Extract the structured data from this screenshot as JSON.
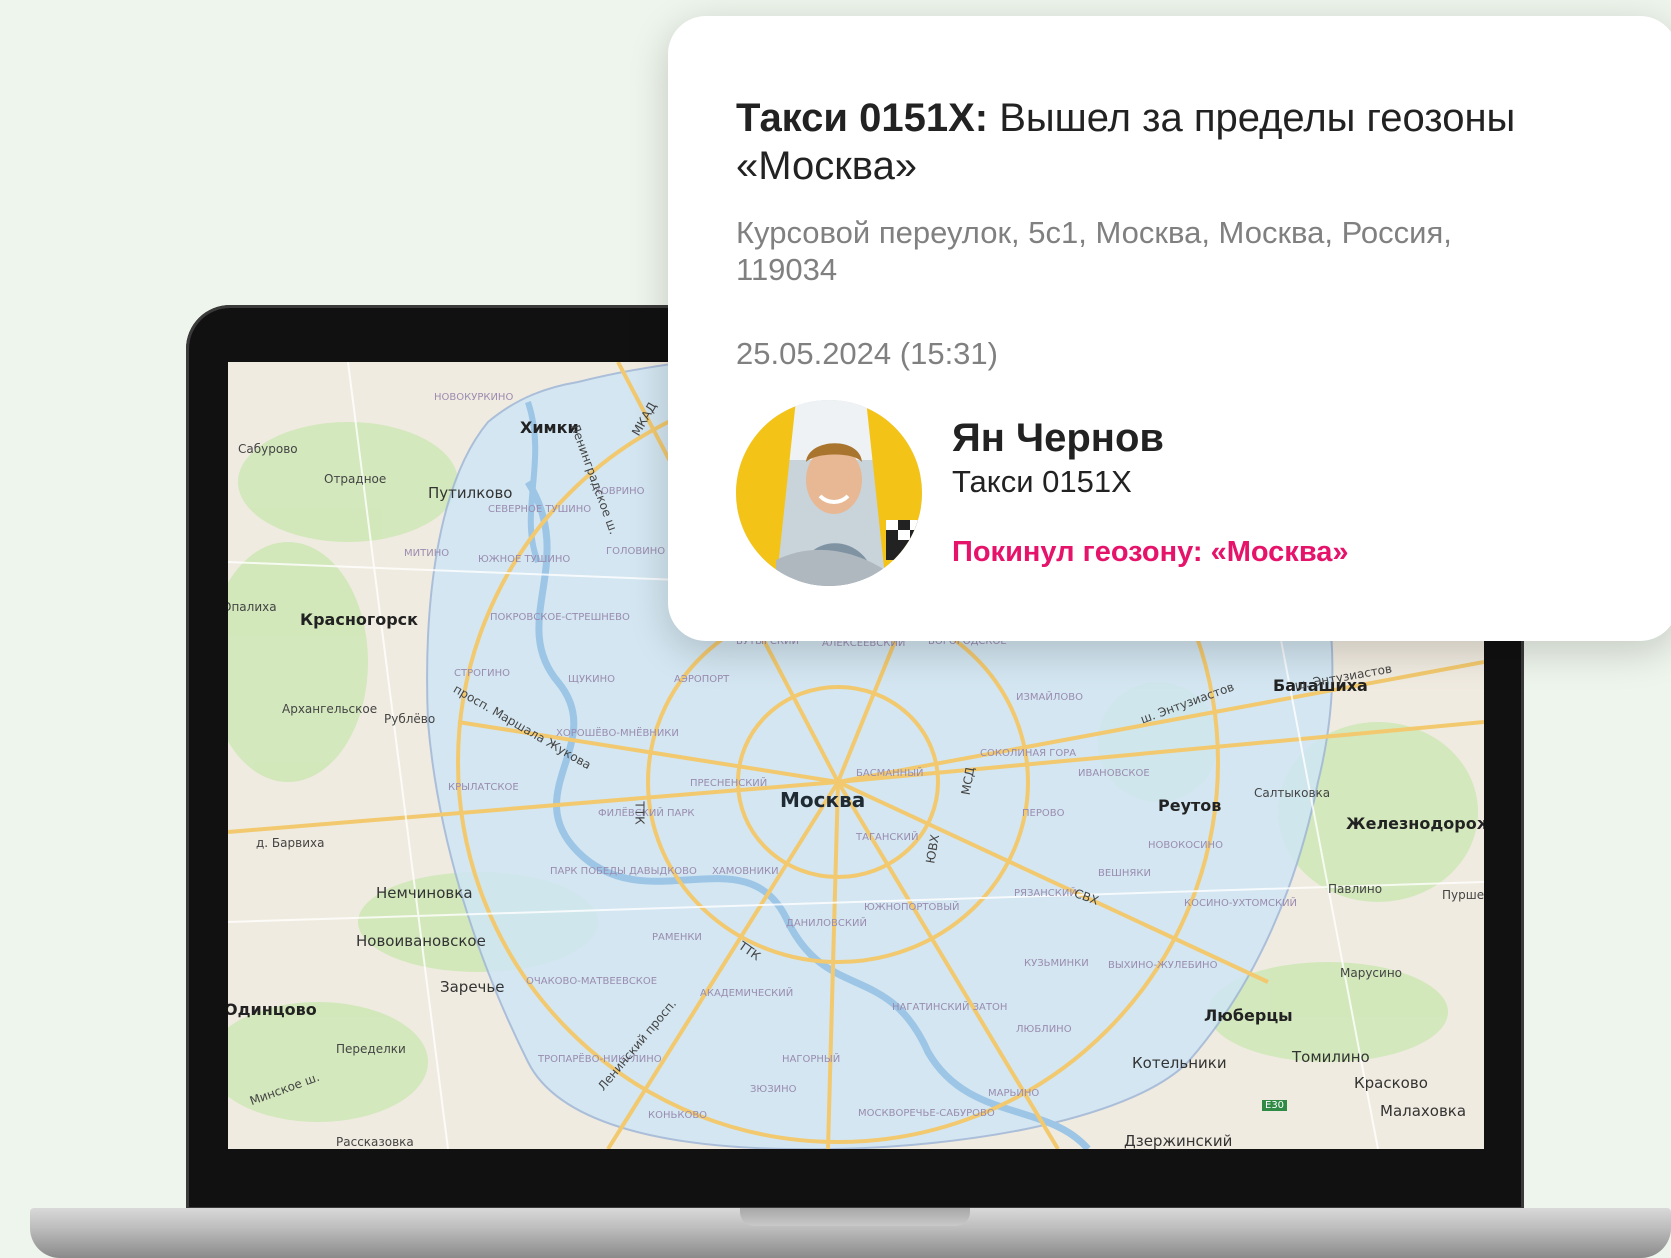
{
  "notification": {
    "title_bold": "Такси 0151X:",
    "title_rest": " Вышел за пределы геозоны «Москва»",
    "address": "Курсовой переулок, 5с1, Москва, Москва, Россия, 119034",
    "datetime": "25.05.2024 (15:31)",
    "driver_name": "Ян Чернов",
    "vehicle": "Такси 0151X",
    "event": "Покинул геозону: «Москва»",
    "event_color": "#e6136b"
  },
  "map": {
    "geofence_color": "#cfe6f5",
    "labels": {
      "khimki": "Химки",
      "sabu": "Сабурово",
      "otradnoe": "Отрадное",
      "putilkovo": "Путилково",
      "krasnogorsk": "Красногорск",
      "opalikha": "Опалиха",
      "arkhangelskoe": "Архангельское",
      "rublevo": "Рублёво",
      "barvikha": "д. Барвиха",
      "nemchinovka": "Немчиновка",
      "novoivanovskoe": "Новоивановское",
      "zarechye": "Заречье",
      "odintsovo": "Одинцово",
      "peredelki": "Переделки",
      "rasskazovka": "Рассказовка",
      "moskva": "Москва",
      "balashikha": "Балашиха",
      "reutov": "Реутов",
      "saltykovka": "Салтыковка",
      "zheleznodorozhny": "Железнодорожный",
      "pavlino": "Павлино",
      "purshevo": "Пуршево",
      "marusino": "Марусино",
      "lyubertsy": "Люберцы",
      "kotelniki": "Котельники",
      "tomilino": "Томилино",
      "kraskovo": "Красково",
      "malakhovka": "Малаховка",
      "dzerzhinsky": "Дзержинский",
      "d1": "Новокуркино",
      "d2": "Ховрино",
      "d3": "Северное Тушино",
      "d4": "Митино",
      "d5": "Южное Тушино",
      "d6": "Головино",
      "d7": "Покровское-Стрешнево",
      "d8": "Строгино",
      "d9": "Щукино",
      "d10": "Аэропорт",
      "d11": "Бутырский",
      "d12": "Алексеевский",
      "d13": "Богородское",
      "d14": "Измайлово",
      "d15": "Хорошёво-Мнёвники",
      "d16": "Соколиная Гора",
      "d17": "Крылатское",
      "d18": "Пресненский",
      "d19": "Басманный",
      "d20": "Ивановское",
      "d21": "Филёвский парк",
      "d22": "Перово",
      "d23": "Таганский",
      "d24": "Новокосино",
      "d25": "Хамовники",
      "d26": "Вешняки",
      "d27": "Парк Победы Давыдково",
      "d28": "Рязанский",
      "d29": "Южнопортовый",
      "d30": "Даниловский",
      "d31": "Косино-Ухтомский",
      "d32": "Раменки",
      "d33": "Кузьминки",
      "d34": "Выхино-Жулебино",
      "d35": "Очаково-Матвеевское",
      "d36": "Академический",
      "d37": "Нагатинский Затон",
      "d38": "Люблино",
      "d39": "Тропарёво-Никулино",
      "d40": "Нагорный",
      "d41": "Зюзино",
      "d42": "Марьино",
      "d43": "Коньково",
      "d44": "Москворечье-Сабурово",
      "r1": "МКАД",
      "r2": "ТТК",
      "r3": "СВХ",
      "r4": "МСД",
      "r5": "ЮВХ",
      "r6": "ш. Энтузиастов",
      "r7": "Ленинградское ш.",
      "r8": "просп. Маршала Жукова",
      "r9": "Ленинский просп.",
      "r10": "Минское ш.",
      "r11": "E30"
    }
  }
}
